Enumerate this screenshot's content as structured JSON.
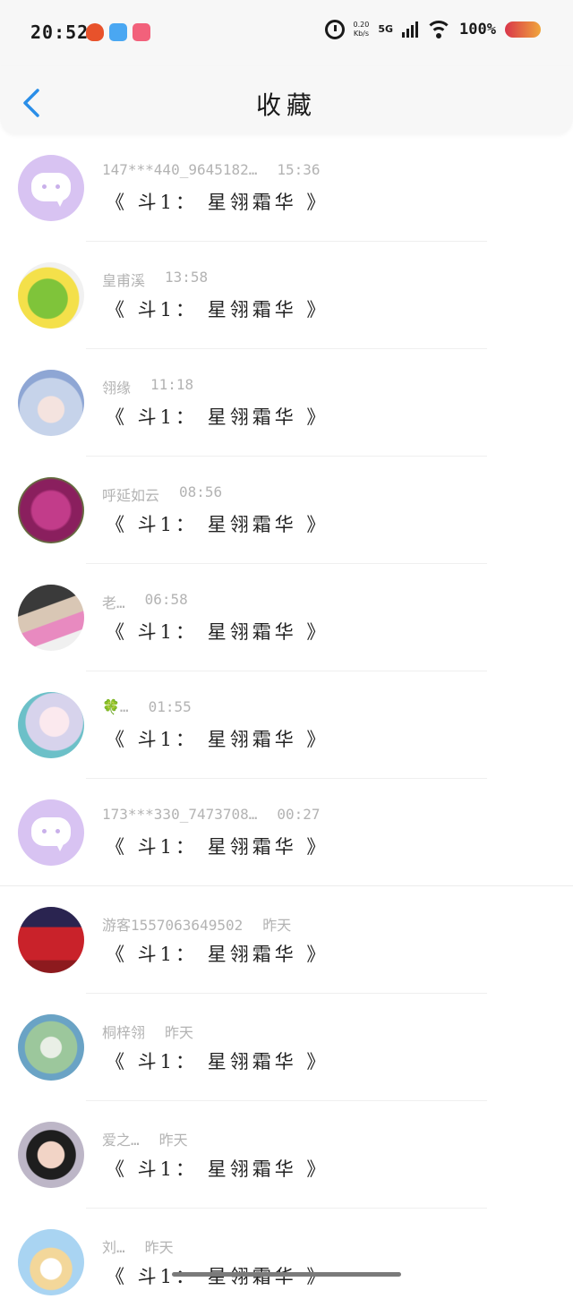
{
  "status": {
    "time": "20:52",
    "net_speed_value": "0.20",
    "net_speed_unit": "Kb/s",
    "network": "5G",
    "battery": "100%",
    "accent": "#e8522b"
  },
  "header": {
    "title": "收藏",
    "back_icon": "chevron-left-icon",
    "accent_color": "#2a8ee8"
  },
  "items": [
    {
      "name": "147***440_9645182…",
      "time": "15:36",
      "message": "《 斗1： 星翎霜华 》",
      "avatar": "default"
    },
    {
      "name": "皇甫溪",
      "time": "13:58",
      "message": "《 斗1： 星翎霜华 》",
      "avatar": "photo-green"
    },
    {
      "name": "翎缘",
      "time": "11:18",
      "message": "《 斗1： 星翎霜华 》",
      "avatar": "photo-anime"
    },
    {
      "name": "呼延如云",
      "time": "08:56",
      "message": "《 斗1： 星翎霜华 》",
      "avatar": "photo-flower"
    },
    {
      "name": "老…",
      "time": "06:58",
      "message": "《 斗1： 星翎霜华 》",
      "avatar": "photo-child"
    },
    {
      "name": "🍀…",
      "time": "01:55",
      "message": "《 斗1： 星翎霜华 》",
      "avatar": "photo-anime-girl"
    },
    {
      "name": "173***330_7473708…",
      "time": "00:27",
      "message": "《 斗1： 星翎霜华 》",
      "avatar": "default"
    },
    {
      "name": "游客1557063649502",
      "time": "昨天",
      "message": "《 斗1： 星翎霜华 》",
      "avatar": "photo-group"
    },
    {
      "name": "桐梓翎",
      "time": "昨天",
      "message": "《 斗1： 星翎霜华 》",
      "avatar": "photo-painting"
    },
    {
      "name": "爱之…",
      "time": "昨天",
      "message": "《 斗1： 星翎霜华 》",
      "avatar": "photo-person"
    },
    {
      "name": "刘…",
      "time": "昨天",
      "message": "《 斗1： 星翎霜华 》",
      "avatar": "photo-cartoon"
    }
  ]
}
